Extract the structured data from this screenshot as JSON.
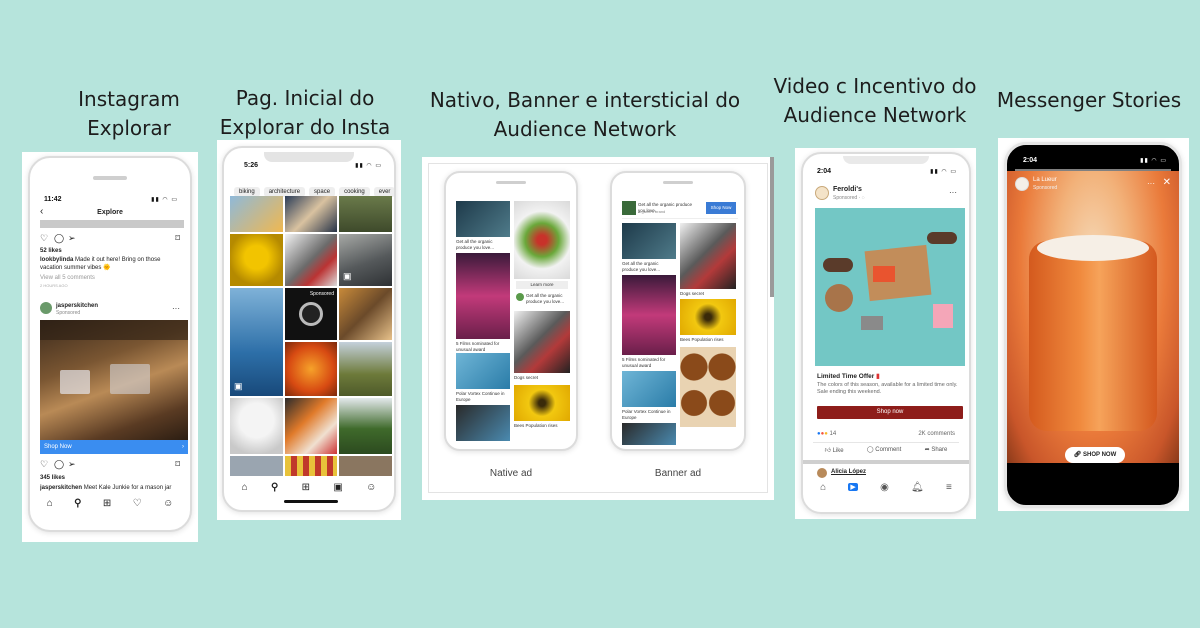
{
  "captions": {
    "c1": [
      "Instagram",
      "Explorar"
    ],
    "c2": [
      "Pag. Inicial do",
      "Explorar do Insta"
    ],
    "c3": [
      "Nativo, Banner e intersticial do",
      "Audience Network"
    ],
    "c4": [
      "Video c Incentivo do",
      "Audience Network"
    ],
    "c5": "Messenger Stories"
  },
  "p1": {
    "time": "11:42",
    "title": "Explore",
    "likes1": "52 likes",
    "caption_user": "lookbylinda",
    "caption_text": "Made it out here! Bring on those vacation summer vibes 🌞",
    "view_comments": "View all 5 comments",
    "time_ago": "2 HOURS AGO",
    "account": "jasperskitchen",
    "sponsored": "Sponsored",
    "cta": "Shop Now",
    "likes2": "345 likes",
    "caption2_user": "jasperskitchen",
    "caption2_text": "Meet Kale Junkie for a mason jar"
  },
  "p2": {
    "time": "5:26",
    "chips": [
      "biking",
      "architecture",
      "space",
      "cooking",
      "ever"
    ],
    "sponsored": "Sponsored"
  },
  "p3": {
    "native_label": "Native ad",
    "banner_label": "Banner ad",
    "pins": {
      "organic": "Get all the organic produce you love...",
      "learn_more": "Learn more",
      "films": "5 Films nominated for unusual award",
      "dogs": "Dogs secret",
      "polar": "Polar Vortex Continue in Europe",
      "bees": "Bees Population rises"
    },
    "banner_text": "Get all the organic produce you love.",
    "banner_sub": "organic’s brand",
    "banner_cta": "Shop Now"
  },
  "p4": {
    "time": "2:04",
    "page": "Feroldi's",
    "sponsored": "Sponsored",
    "offer_title": "Limited Time Offer",
    "offer_text": "The colors of this season, available for a limited time only. Sale ending this weekend.",
    "cta": "Shop now",
    "reactions_count": "14",
    "comments_count": "2K comments",
    "like": "Like",
    "comment": "Comment",
    "share": "Share",
    "commenter": "Alicia López"
  },
  "p5": {
    "time": "2:04",
    "brand": "La Lueur",
    "sponsored": "Sponsored",
    "cta": "SHOP NOW"
  }
}
